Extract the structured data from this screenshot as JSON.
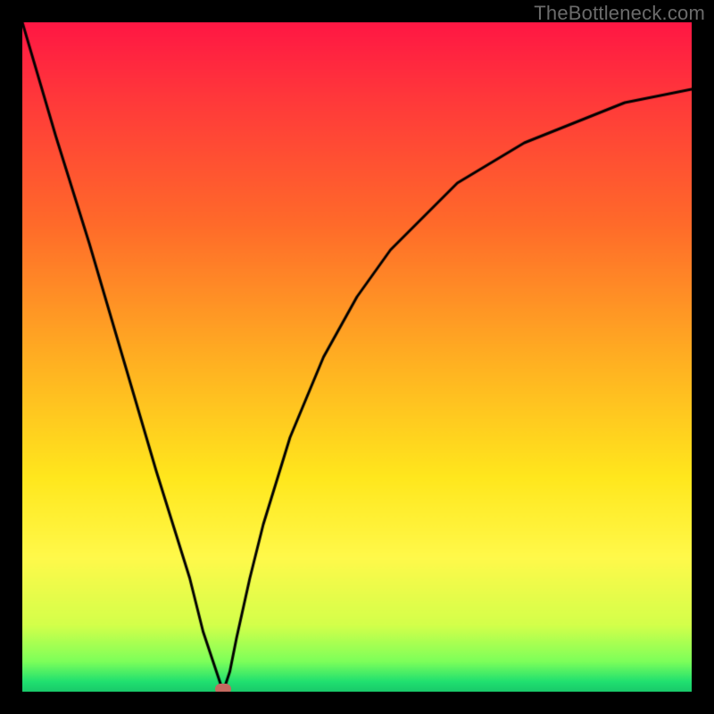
{
  "watermark": "TheBottleneck.com",
  "chart_data": {
    "type": "line",
    "title": "",
    "xlabel": "",
    "ylabel": "",
    "xlim": [
      0,
      100
    ],
    "ylim": [
      0,
      100
    ],
    "x": [
      0,
      5,
      10,
      15,
      20,
      25,
      27,
      29,
      30,
      31,
      32,
      34,
      36,
      40,
      45,
      50,
      55,
      60,
      65,
      70,
      75,
      80,
      85,
      90,
      95,
      100
    ],
    "values": [
      100,
      83,
      67,
      50,
      33,
      17,
      9,
      3,
      0,
      3,
      8,
      17,
      25,
      38,
      50,
      59,
      66,
      71,
      76,
      79,
      82,
      84,
      86,
      88,
      89,
      90
    ],
    "series_name": "bottleneck-curve",
    "marker": {
      "x": 30,
      "y": 0,
      "color": "#c46a60"
    },
    "gradient_stops": [
      {
        "offset": 0.0,
        "color": "#ff1744"
      },
      {
        "offset": 0.12,
        "color": "#ff3a3a"
      },
      {
        "offset": 0.3,
        "color": "#ff6a2a"
      },
      {
        "offset": 0.5,
        "color": "#ffae22"
      },
      {
        "offset": 0.68,
        "color": "#ffe71d"
      },
      {
        "offset": 0.8,
        "color": "#fff94a"
      },
      {
        "offset": 0.9,
        "color": "#d4ff4a"
      },
      {
        "offset": 0.955,
        "color": "#7dff5a"
      },
      {
        "offset": 0.985,
        "color": "#20e070"
      },
      {
        "offset": 1.0,
        "color": "#19c96a"
      }
    ],
    "curve_style": {
      "stroke": "#000000",
      "stroke_width": 3
    }
  }
}
